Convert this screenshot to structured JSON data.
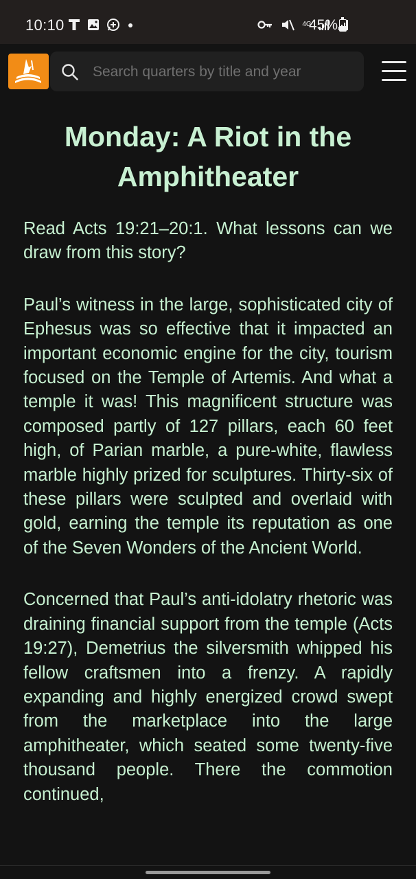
{
  "status_bar": {
    "time": "10:10",
    "left_icons": [
      "t-mobile-icon",
      "image-icon",
      "whatsapp-icon",
      "dot-icon"
    ],
    "right_icons": [
      "vpn-key-icon",
      "mute-icon",
      "4g-icon",
      "signal-icon",
      "signal-icon"
    ],
    "network_label": "4G",
    "battery_percent": "45%",
    "battery_level": 0.45
  },
  "app_bar": {
    "logo_icon": "adventist-logo-icon",
    "search_placeholder": "Search quarters by title and year",
    "search_value": "",
    "menu_icon": "hamburger-menu-icon",
    "accent_color": "#f28c16"
  },
  "article": {
    "title": "Monday: A Riot in the Amphitheater",
    "paragraphs": [
      "Read Acts 19:21–20:1. What lessons can we draw from this story?",
      "Paul’s witness in the large, sophisticated city of Ephesus was so effective that it impacted an important economic engine for the city, tourism focused on the Temple of Artemis. And what a temple it was! This magnificent structure was composed partly of 127 pillars, each 60 feet high, of Parian marble, a pure-white, flawless marble highly prized for sculptures. Thirty-six of these pillars were sculpted and overlaid with gold, earning the temple its reputation as one of the Seven Wonders of the Ancient World.",
      "Concerned that Paul’s anti-idolatry rhetoric was draining financial support from the temple (Acts 19:27), Demetrius the silversmith whipped his fellow craftsmen into a frenzy. A rapidly expanding and highly energized crowd swept from the marketplace into the large amphitheater, which seated some twenty-five thousand people. There the commotion continued,"
    ],
    "text_color": "#c6f0d0"
  }
}
